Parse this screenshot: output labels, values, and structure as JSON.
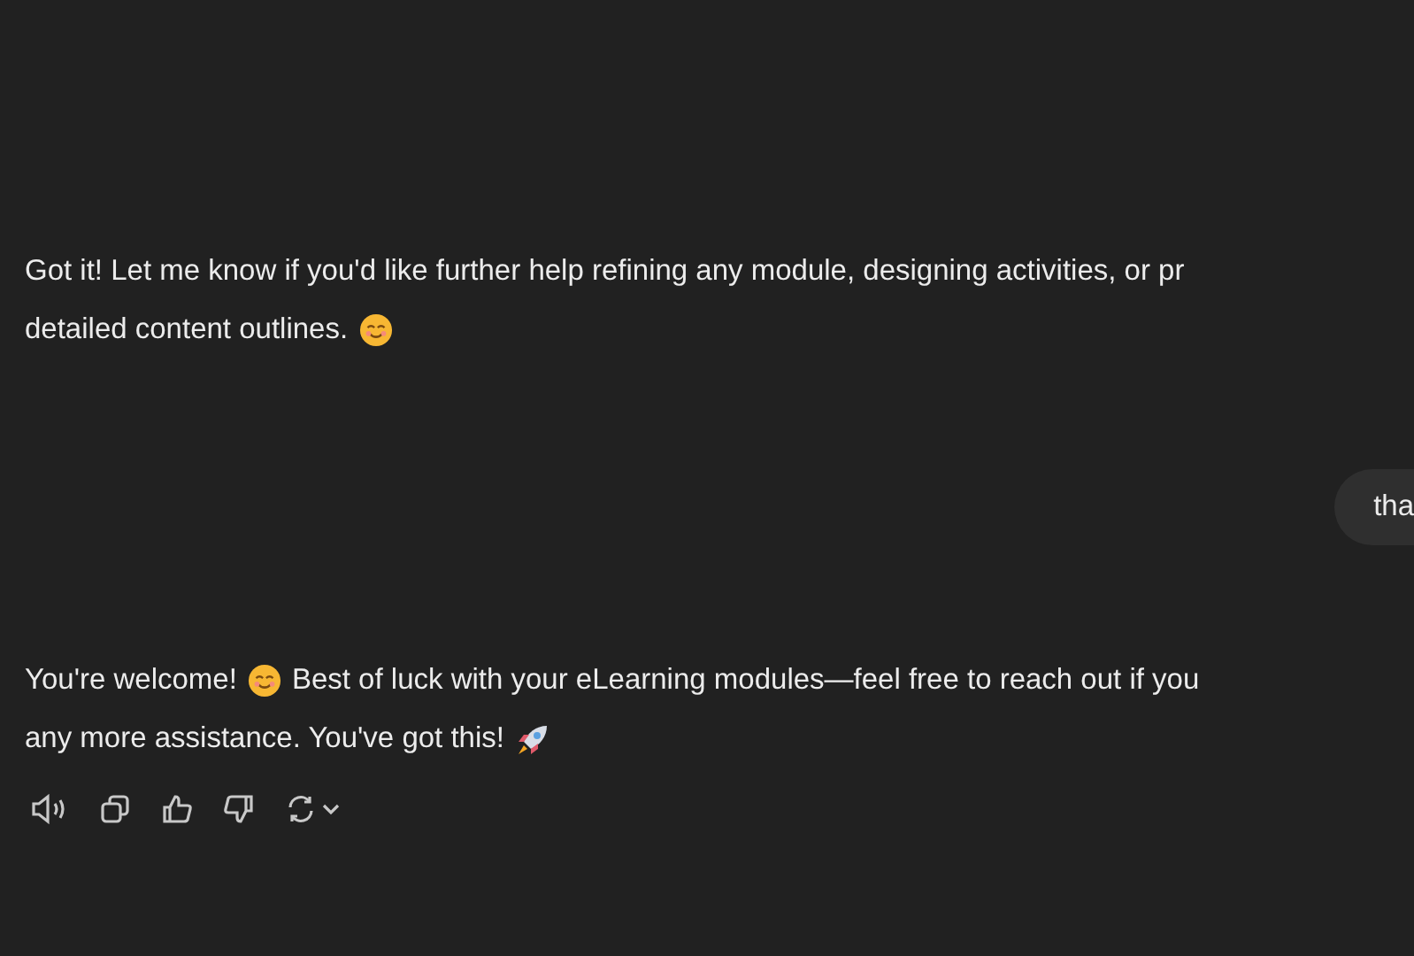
{
  "messages": [
    {
      "kind": "assistant",
      "lines": [
        {
          "parts": [
            {
              "kind": "text",
              "text": "Got it! Let me know if you'd like further help refining any module, designing activities, or pr"
            }
          ]
        },
        {
          "parts": [
            {
              "kind": "text",
              "text": "detailed content outlines."
            },
            {
              "kind": "smile"
            }
          ]
        }
      ]
    },
    {
      "kind": "user",
      "text": "tha"
    },
    {
      "kind": "assistant",
      "lines": [
        {
          "parts": [
            {
              "kind": "text",
              "text": "You're welcome!"
            },
            {
              "kind": "smile"
            },
            {
              "kind": "text",
              "text": "Best of luck with your eLearning modules—feel free to reach out if you"
            }
          ]
        },
        {
          "parts": [
            {
              "kind": "text",
              "text": "any more assistance. You've got this!"
            },
            {
              "kind": "rocket"
            }
          ]
        }
      ],
      "actions": [
        {
          "kind": "speaker"
        },
        {
          "kind": "copy"
        },
        {
          "kind": "like"
        },
        {
          "kind": "dislike"
        },
        {
          "kind": "regenerate"
        }
      ]
    }
  ]
}
